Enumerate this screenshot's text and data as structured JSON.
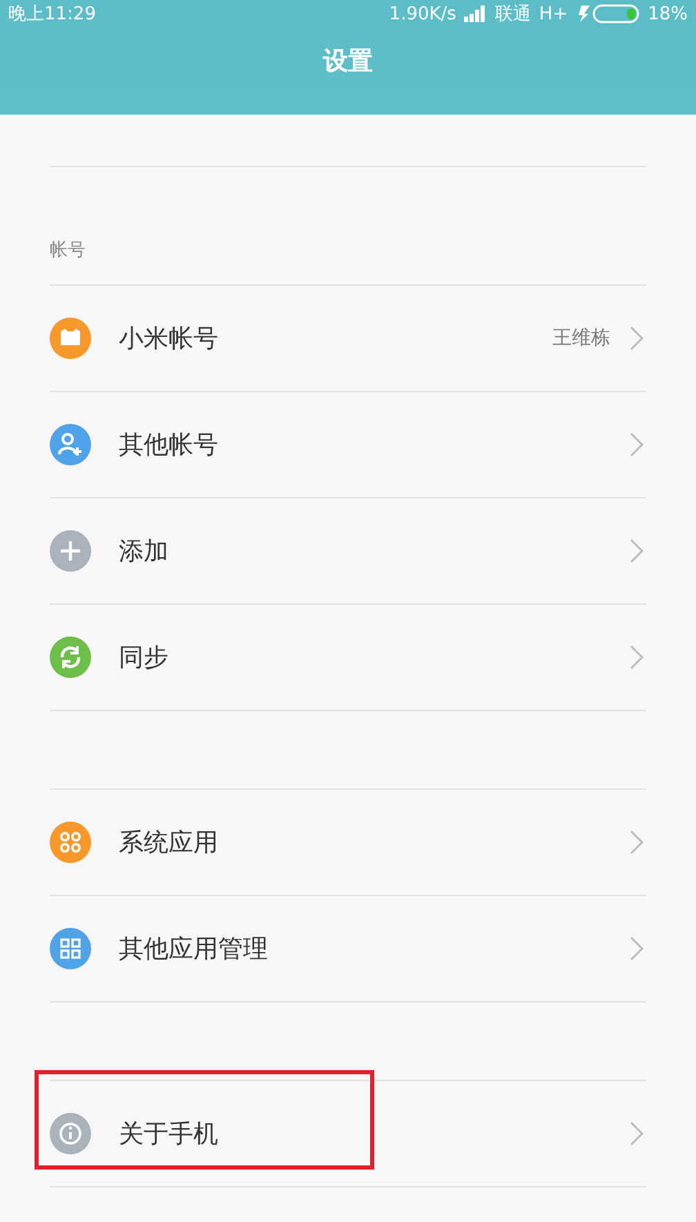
{
  "status_bar": {
    "time": "晚上11:29",
    "speed": "1.90K/s",
    "carrier": "联通",
    "network": "H+",
    "battery": "18%"
  },
  "header": {
    "title": "设置"
  },
  "groups": [
    {
      "label": "帐号",
      "rows": [
        {
          "label": "小米帐号",
          "value": "王维栋",
          "kind": "mi",
          "color": "#f6992a",
          "highlighted": false
        },
        {
          "label": "其他帐号",
          "kind": "person-add",
          "color": "#4fa3e6",
          "highlighted": false
        },
        {
          "label": "添加",
          "kind": "plus",
          "color": "#aab2bb",
          "highlighted": false
        },
        {
          "label": "同步",
          "kind": "sync",
          "color": "#6cc04a",
          "highlighted": false
        }
      ]
    },
    {
      "rows": [
        {
          "label": "系统应用",
          "kind": "dots",
          "color": "#f6992a",
          "highlighted": false
        },
        {
          "label": "其他应用管理",
          "kind": "grid",
          "color": "#4fa3e6",
          "highlighted": false
        }
      ]
    },
    {
      "rows": [
        {
          "label": "关于手机",
          "kind": "info",
          "color": "#aab2bb",
          "highlighted": true
        }
      ]
    }
  ]
}
